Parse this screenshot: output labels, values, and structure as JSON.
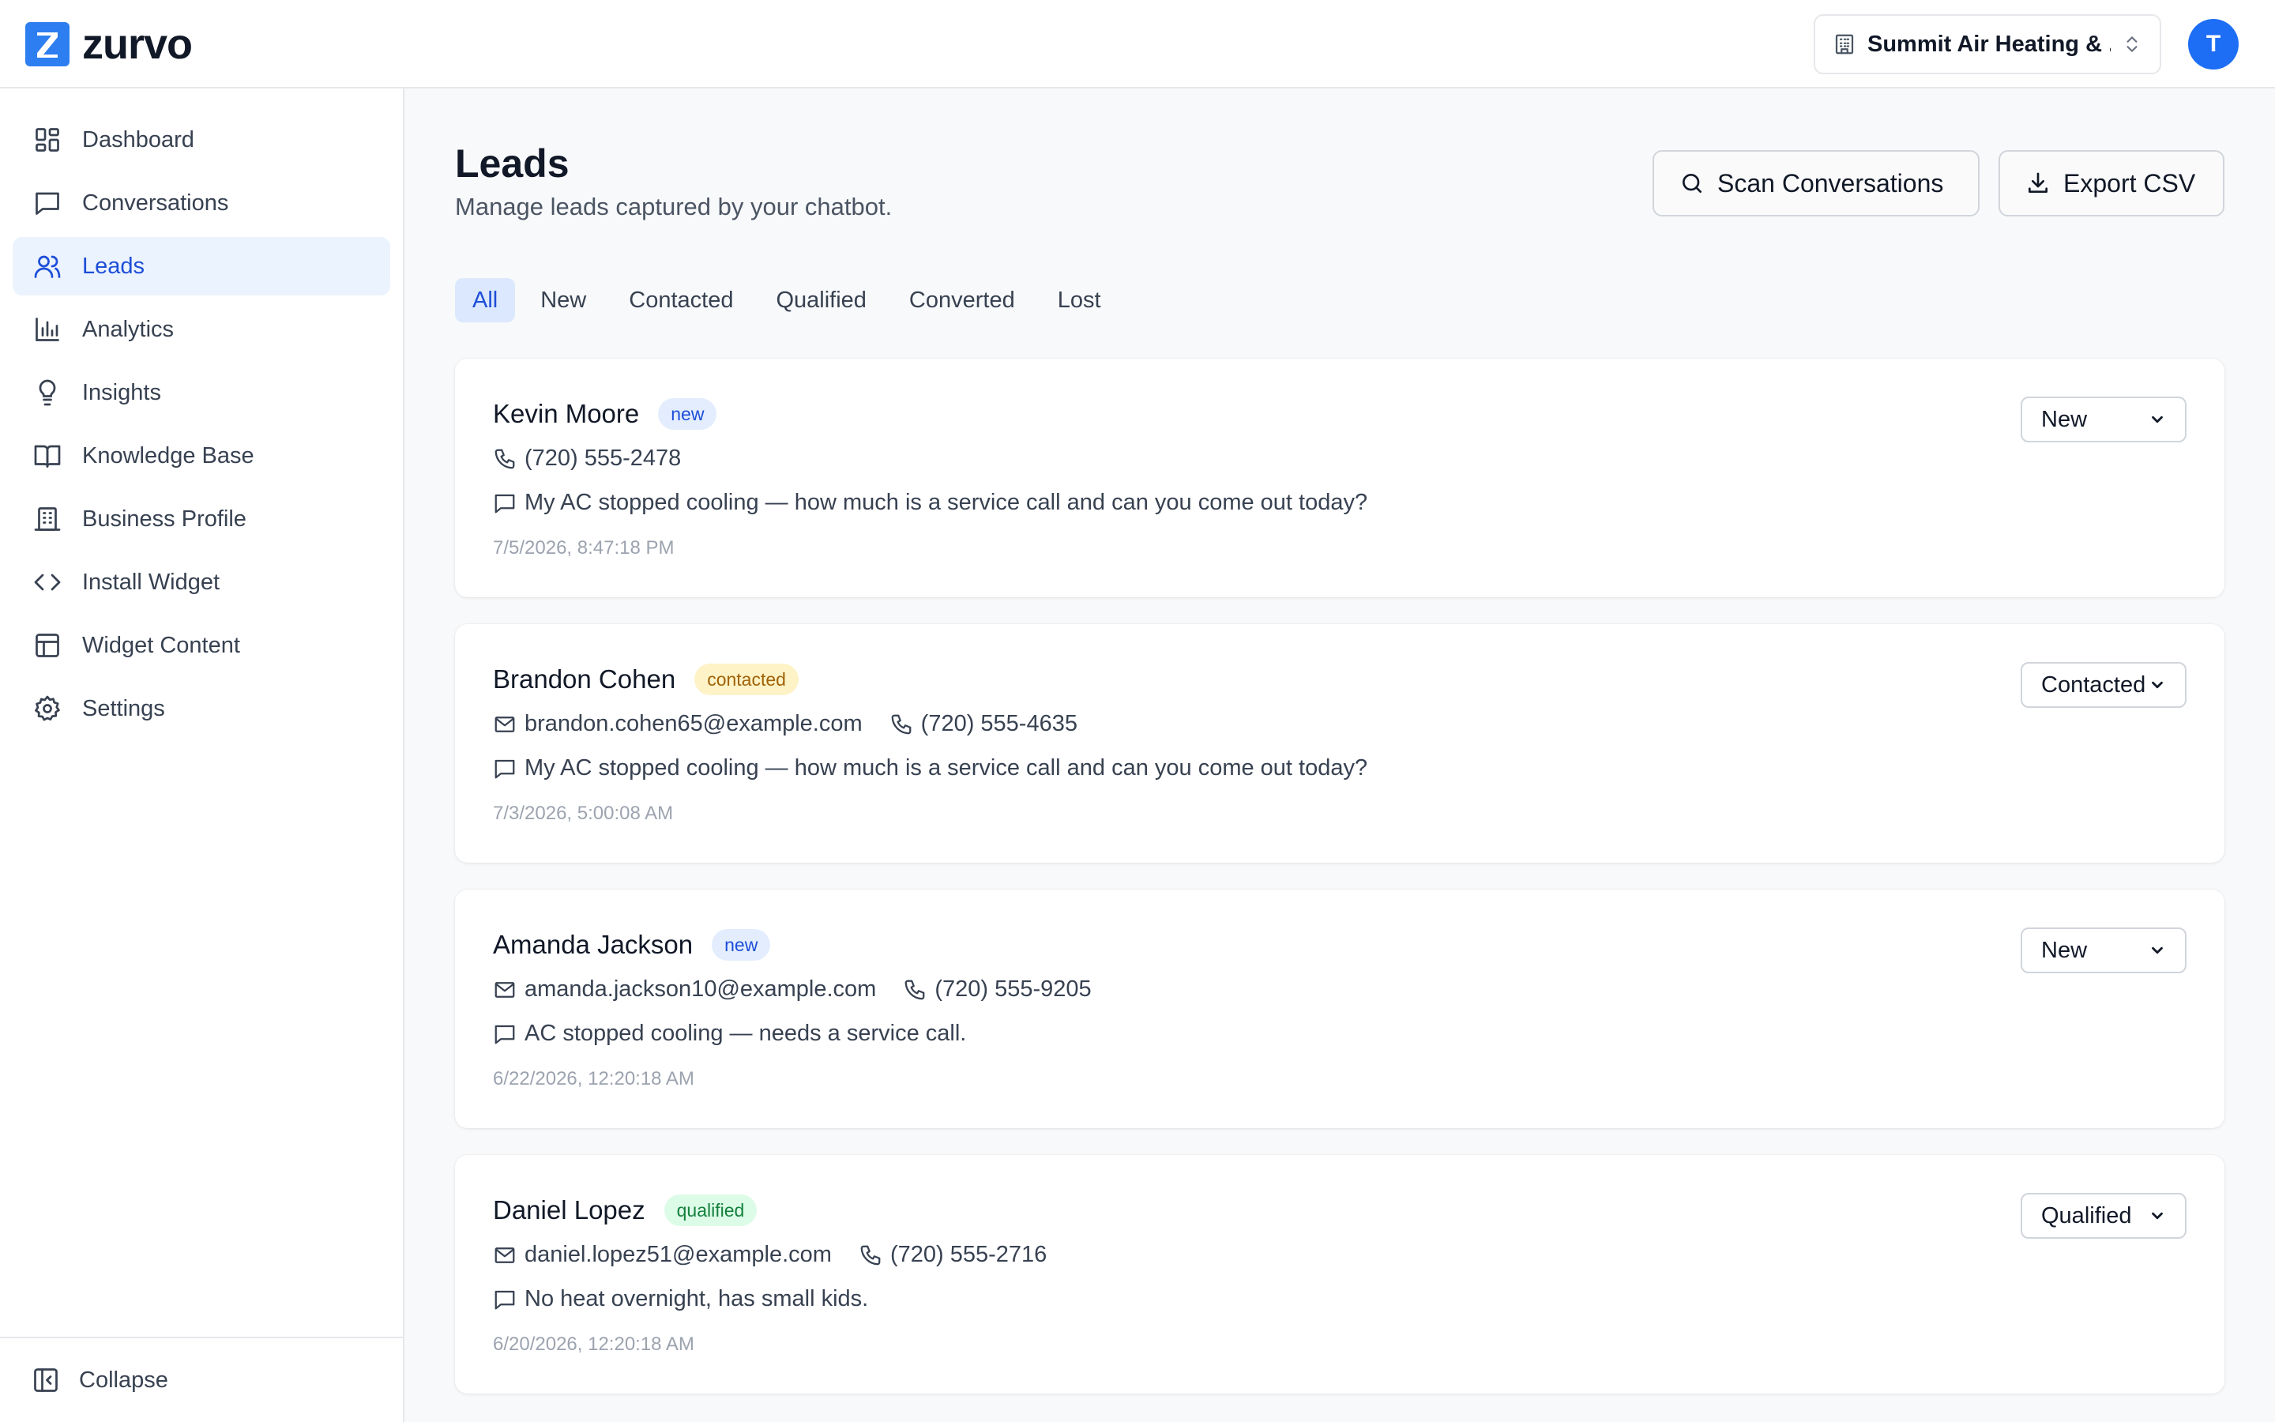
{
  "app": {
    "logo_text": "zurvo",
    "logo_letter": "Z",
    "business_name": "Summit Air Heating & ...",
    "avatar_initial": "T"
  },
  "sidebar": {
    "items": [
      {
        "label": "Dashboard",
        "icon": "dashboard-icon"
      },
      {
        "label": "Conversations",
        "icon": "message-icon"
      },
      {
        "label": "Leads",
        "icon": "users-icon",
        "active": true
      },
      {
        "label": "Analytics",
        "icon": "bar-chart-icon"
      },
      {
        "label": "Insights",
        "icon": "lightbulb-icon"
      },
      {
        "label": "Knowledge Base",
        "icon": "book-icon"
      },
      {
        "label": "Business Profile",
        "icon": "building-icon"
      },
      {
        "label": "Install Widget",
        "icon": "code-icon"
      },
      {
        "label": "Widget Content",
        "icon": "layout-icon"
      },
      {
        "label": "Settings",
        "icon": "gear-icon"
      }
    ],
    "collapse_label": "Collapse"
  },
  "page": {
    "title": "Leads",
    "subtitle": "Manage leads captured by your chatbot.",
    "scan_button": "Scan Conversations",
    "export_button": "Export CSV"
  },
  "tabs": [
    {
      "label": "All",
      "active": true
    },
    {
      "label": "New"
    },
    {
      "label": "Contacted"
    },
    {
      "label": "Qualified"
    },
    {
      "label": "Converted"
    },
    {
      "label": "Lost"
    }
  ],
  "leads": [
    {
      "name": "Kevin Moore",
      "badge": "new",
      "email": "",
      "phone": "(720) 555-2478",
      "message": "My AC stopped cooling — how much is a service call and can you come out today?",
      "timestamp": "7/5/2026, 8:47:18 PM",
      "status": "New"
    },
    {
      "name": "Brandon Cohen",
      "badge": "contacted",
      "email": "brandon.cohen65@example.com",
      "phone": "(720) 555-4635",
      "message": "My AC stopped cooling — how much is a service call and can you come out today?",
      "timestamp": "7/3/2026, 5:00:08 AM",
      "status": "Contacted"
    },
    {
      "name": "Amanda Jackson",
      "badge": "new",
      "email": "amanda.jackson10@example.com",
      "phone": "(720) 555-9205",
      "message": "AC stopped cooling — needs a service call.",
      "timestamp": "6/22/2026, 12:20:18 AM",
      "status": "New"
    },
    {
      "name": "Daniel Lopez",
      "badge": "qualified",
      "email": "daniel.lopez51@example.com",
      "phone": "(720) 555-2716",
      "message": "No heat overnight, has small kids.",
      "timestamp": "6/20/2026, 12:20:18 AM",
      "status": "Qualified"
    }
  ],
  "colors": {
    "accent": "#1d4ed8",
    "brand": "#2d7ef0",
    "avatar": "#1d6ef5"
  }
}
